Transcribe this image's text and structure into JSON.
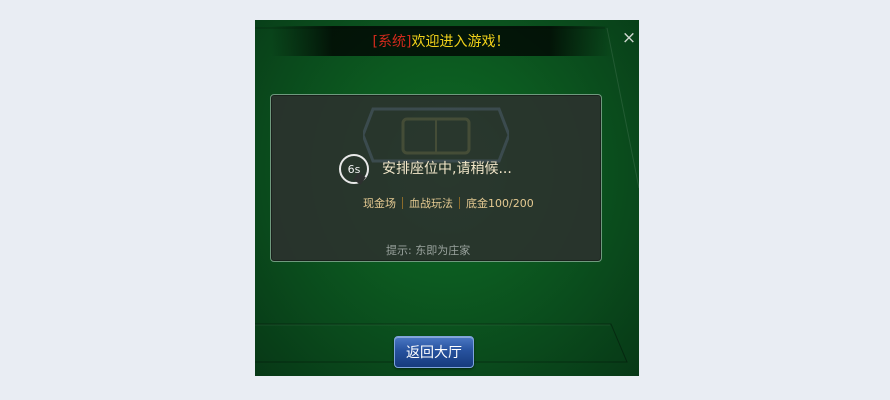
{
  "system_bar": {
    "tag": "[系统]",
    "message": "欢迎进入游戏！"
  },
  "close_icon": "×",
  "dialog": {
    "timer": "6s",
    "status": "安排座位中,请稍候...",
    "room_info": {
      "mode": "现金场",
      "rule": "血战玩法",
      "stake": "底金100/200"
    },
    "hint": "提示: 东即为庄家"
  },
  "return_button": {
    "label": "返回大厅"
  },
  "colors": {
    "table_green": "#0c5a20",
    "system_tag": "#d02a1c",
    "system_message": "#f2d21a",
    "status_text": "#f1e6c9",
    "room_info_text": "#e4c991",
    "button_blue": "#27529e"
  },
  "icons": {
    "close": "close-icon",
    "timer": "timer-icon"
  }
}
